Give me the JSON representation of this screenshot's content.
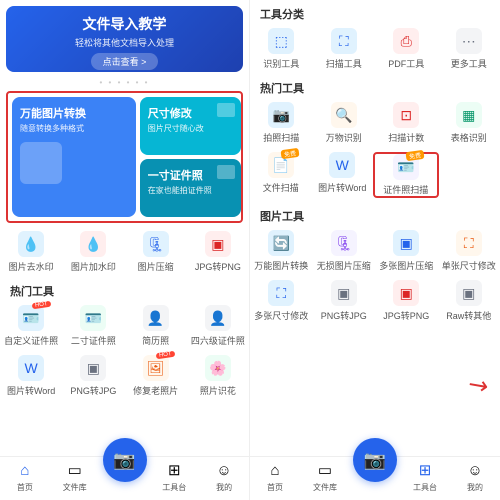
{
  "left": {
    "banner": {
      "title": "文件导入教学",
      "sub": "轻松将其他文档导入处理",
      "btn": "点击查看 >"
    },
    "hero": [
      {
        "title": "万能图片转换",
        "sub": "随意转换多种格式"
      },
      {
        "title": "尺寸修改",
        "sub": "图片尺寸随心改"
      },
      {
        "title": "一寸证件照",
        "sub": "在家也能拍证件照"
      }
    ],
    "row1": [
      "图片去水印",
      "图片加水印",
      "图片压缩",
      "JPG转PNG"
    ],
    "sec1": "热门工具",
    "row2": [
      "自定义证件照",
      "二寸证件照",
      "简历照",
      "四六级证件照"
    ],
    "row3": [
      "图片转Word",
      "PNG转JPG",
      "修复老照片",
      "照片识花"
    ],
    "nav": [
      "首页",
      "文件库",
      "",
      "工具台",
      "我的"
    ],
    "hot": "HOT"
  },
  "right": {
    "sec1": "工具分类",
    "row1": [
      "识别工具",
      "扫描工具",
      "PDF工具",
      "更多工具"
    ],
    "sec2": "热门工具",
    "row2": [
      "拍照扫描",
      "万物识别",
      "扫描计数",
      "表格识别"
    ],
    "row3": [
      "文件扫描",
      "图片转Word",
      "证件照扫描",
      ""
    ],
    "sec3": "图片工具",
    "row4": [
      "万能图片转换",
      "无损图片压缩",
      "多张图片压缩",
      "单张尺寸修改"
    ],
    "row5": [
      "多张尺寸修改",
      "PNG转JPG",
      "JPG转PNG",
      "Raw转其他"
    ],
    "nav": [
      "首页",
      "文件库",
      "",
      "工具台",
      "我的"
    ],
    "free": "免费"
  }
}
